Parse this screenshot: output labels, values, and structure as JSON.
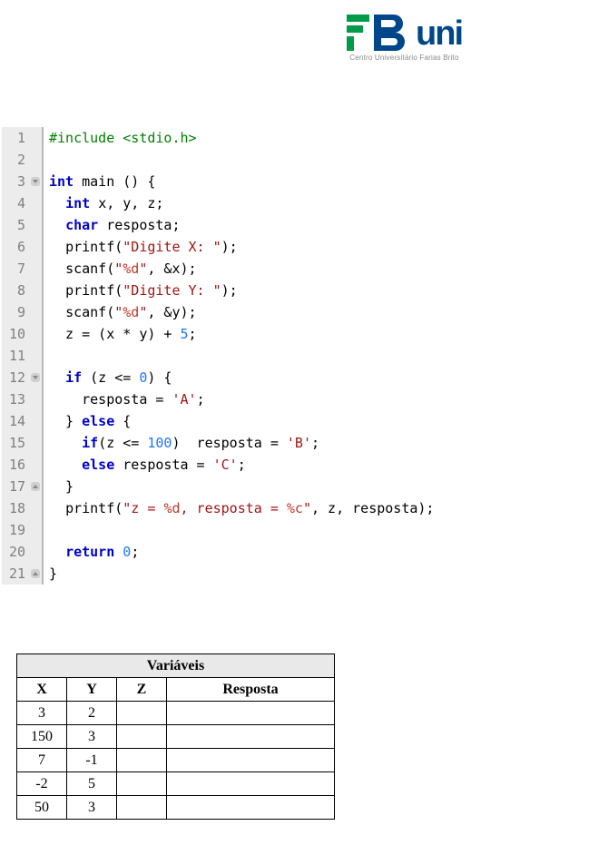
{
  "logo": {
    "uni": "uni",
    "tagline": "Centro Universitário Farias Brito"
  },
  "code": {
    "lines": [
      {
        "n": "1",
        "fold": "",
        "html": "<span class='pp'>#include &lt;stdio.h&gt;</span>"
      },
      {
        "n": "2",
        "fold": "",
        "html": ""
      },
      {
        "n": "3",
        "fold": "down",
        "html": "<span class='kw'>int</span> <span class='fn'>main</span> () {"
      },
      {
        "n": "4",
        "fold": "",
        "html": "  <span class='kw'>int</span> <span class='id'>x, y, z;</span>"
      },
      {
        "n": "5",
        "fold": "",
        "html": "  <span class='kw'>char</span> <span class='id'>resposta;</span>"
      },
      {
        "n": "6",
        "fold": "",
        "html": "  <span class='id'>printf</span>(<span class='str'>\"Digite X: \"</span>);"
      },
      {
        "n": "7",
        "fold": "",
        "html": "  <span class='id'>scanf</span>(<span class='str'>\"</span><span class='fmt'>%d</span><span class='str'>\"</span>, &amp;x);"
      },
      {
        "n": "8",
        "fold": "",
        "html": "  <span class='id'>printf</span>(<span class='str'>\"Digite Y: \"</span>);"
      },
      {
        "n": "9",
        "fold": "",
        "html": "  <span class='id'>scanf</span>(<span class='str'>\"</span><span class='fmt'>%d</span><span class='str'>\"</span>, &amp;y);"
      },
      {
        "n": "10",
        "fold": "",
        "html": "  z = (x * y) + <span class='num'>5</span>;"
      },
      {
        "n": "11",
        "fold": "",
        "html": ""
      },
      {
        "n": "12",
        "fold": "down",
        "html": "  <span class='kw'>if</span> (z &lt;= <span class='num'>0</span>) {"
      },
      {
        "n": "13",
        "fold": "",
        "html": "    resposta = <span class='ch'>'A'</span>;"
      },
      {
        "n": "14",
        "fold": "",
        "html": "  } <span class='kw'>else</span> {"
      },
      {
        "n": "15",
        "fold": "",
        "html": "    <span class='kw'>if</span>(z &lt;= <span class='num'>100</span>)  resposta = <span class='ch'>'B'</span>;"
      },
      {
        "n": "16",
        "fold": "",
        "html": "    <span class='kw'>else</span> resposta = <span class='ch'>'C'</span>;"
      },
      {
        "n": "17",
        "fold": "up",
        "html": "  }"
      },
      {
        "n": "18",
        "fold": "",
        "html": "  <span class='id'>printf</span>(<span class='str'>\"z = </span><span class='fmt'>%d</span><span class='str'>, resposta = </span><span class='fmt'>%c</span><span class='str'>\"</span>, z, resposta);"
      },
      {
        "n": "19",
        "fold": "",
        "html": ""
      },
      {
        "n": "20",
        "fold": "",
        "html": "  <span class='kw'>return</span> <span class='num'>0</span>;"
      },
      {
        "n": "21",
        "fold": "up",
        "html": "}"
      }
    ]
  },
  "table": {
    "title": "Variáveis",
    "headers": {
      "x": "X",
      "y": "Y",
      "z": "Z",
      "r": "Resposta"
    },
    "rows": [
      {
        "x": "3",
        "y": "2",
        "z": "",
        "r": ""
      },
      {
        "x": "150",
        "y": "3",
        "z": "",
        "r": ""
      },
      {
        "x": "7",
        "y": "-1",
        "z": "",
        "r": ""
      },
      {
        "x": "-2",
        "y": "5",
        "z": "",
        "r": ""
      },
      {
        "x": "50",
        "y": "3",
        "z": "",
        "r": ""
      }
    ]
  }
}
